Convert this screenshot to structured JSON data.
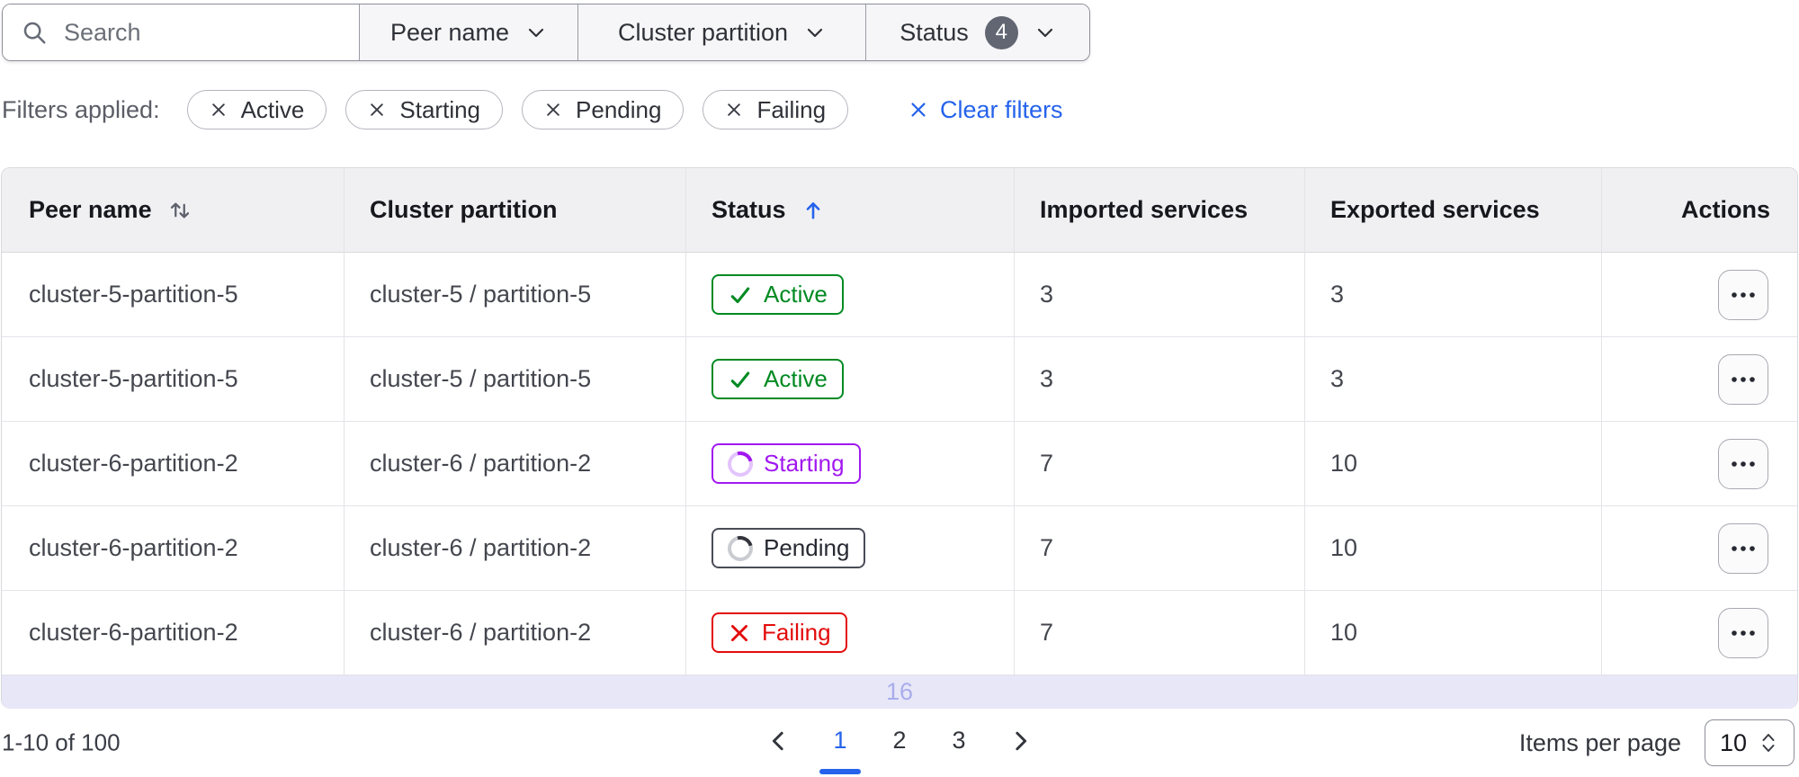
{
  "colors": {
    "accent_blue": "#2563eb",
    "success_green": "#008a22",
    "starting_purple": "#a118f0",
    "failing_red": "#e30b0b",
    "pending_dark": "#4a4d57",
    "status_count_badge_bg": "#616672",
    "partial_row_bg": "#e7e7f8",
    "partial_row_text_color": "#a9adeb"
  },
  "filter_bar": {
    "search_placeholder": "Search",
    "dropdowns": [
      {
        "label": "Peer name"
      },
      {
        "label": "Cluster partition"
      },
      {
        "label": "Status",
        "badge": "4"
      }
    ]
  },
  "filters_applied": {
    "label": "Filters applied:",
    "chips": [
      "Active",
      "Starting",
      "Pending",
      "Failing"
    ],
    "clear_label": "Clear filters"
  },
  "table": {
    "columns": [
      {
        "label": "Peer name",
        "sortable": true,
        "sort": "none"
      },
      {
        "label": "Cluster partition",
        "sortable": false
      },
      {
        "label": "Status",
        "sortable": true,
        "sort": "asc"
      },
      {
        "label": "Imported services",
        "sortable": false
      },
      {
        "label": "Exported services",
        "sortable": false
      },
      {
        "label": "Actions",
        "sortable": false
      }
    ],
    "rows": [
      {
        "peer_name": "cluster-5-partition-5",
        "cluster_partition": "cluster-5 / partition-5",
        "status": "Active",
        "imported_services": "3",
        "exported_services": "3"
      },
      {
        "peer_name": "cluster-5-partition-5",
        "cluster_partition": "cluster-5 / partition-5",
        "status": "Active",
        "imported_services": "3",
        "exported_services": "3"
      },
      {
        "peer_name": "cluster-6-partition-2",
        "cluster_partition": "cluster-6 / partition-2",
        "status": "Starting",
        "imported_services": "7",
        "exported_services": "10"
      },
      {
        "peer_name": "cluster-6-partition-2",
        "cluster_partition": "cluster-6 / partition-2",
        "status": "Pending",
        "imported_services": "7",
        "exported_services": "10"
      },
      {
        "peer_name": "cluster-6-partition-2",
        "cluster_partition": "cluster-6 / partition-2",
        "status": "Failing",
        "imported_services": "7",
        "exported_services": "10"
      }
    ],
    "partial_row_text": "16"
  },
  "pagination": {
    "range_label": "1-10 of 100",
    "pages": [
      "1",
      "2",
      "3"
    ],
    "current_page": "1",
    "items_per_page_label": "Items per page",
    "items_per_page_value": "10"
  }
}
